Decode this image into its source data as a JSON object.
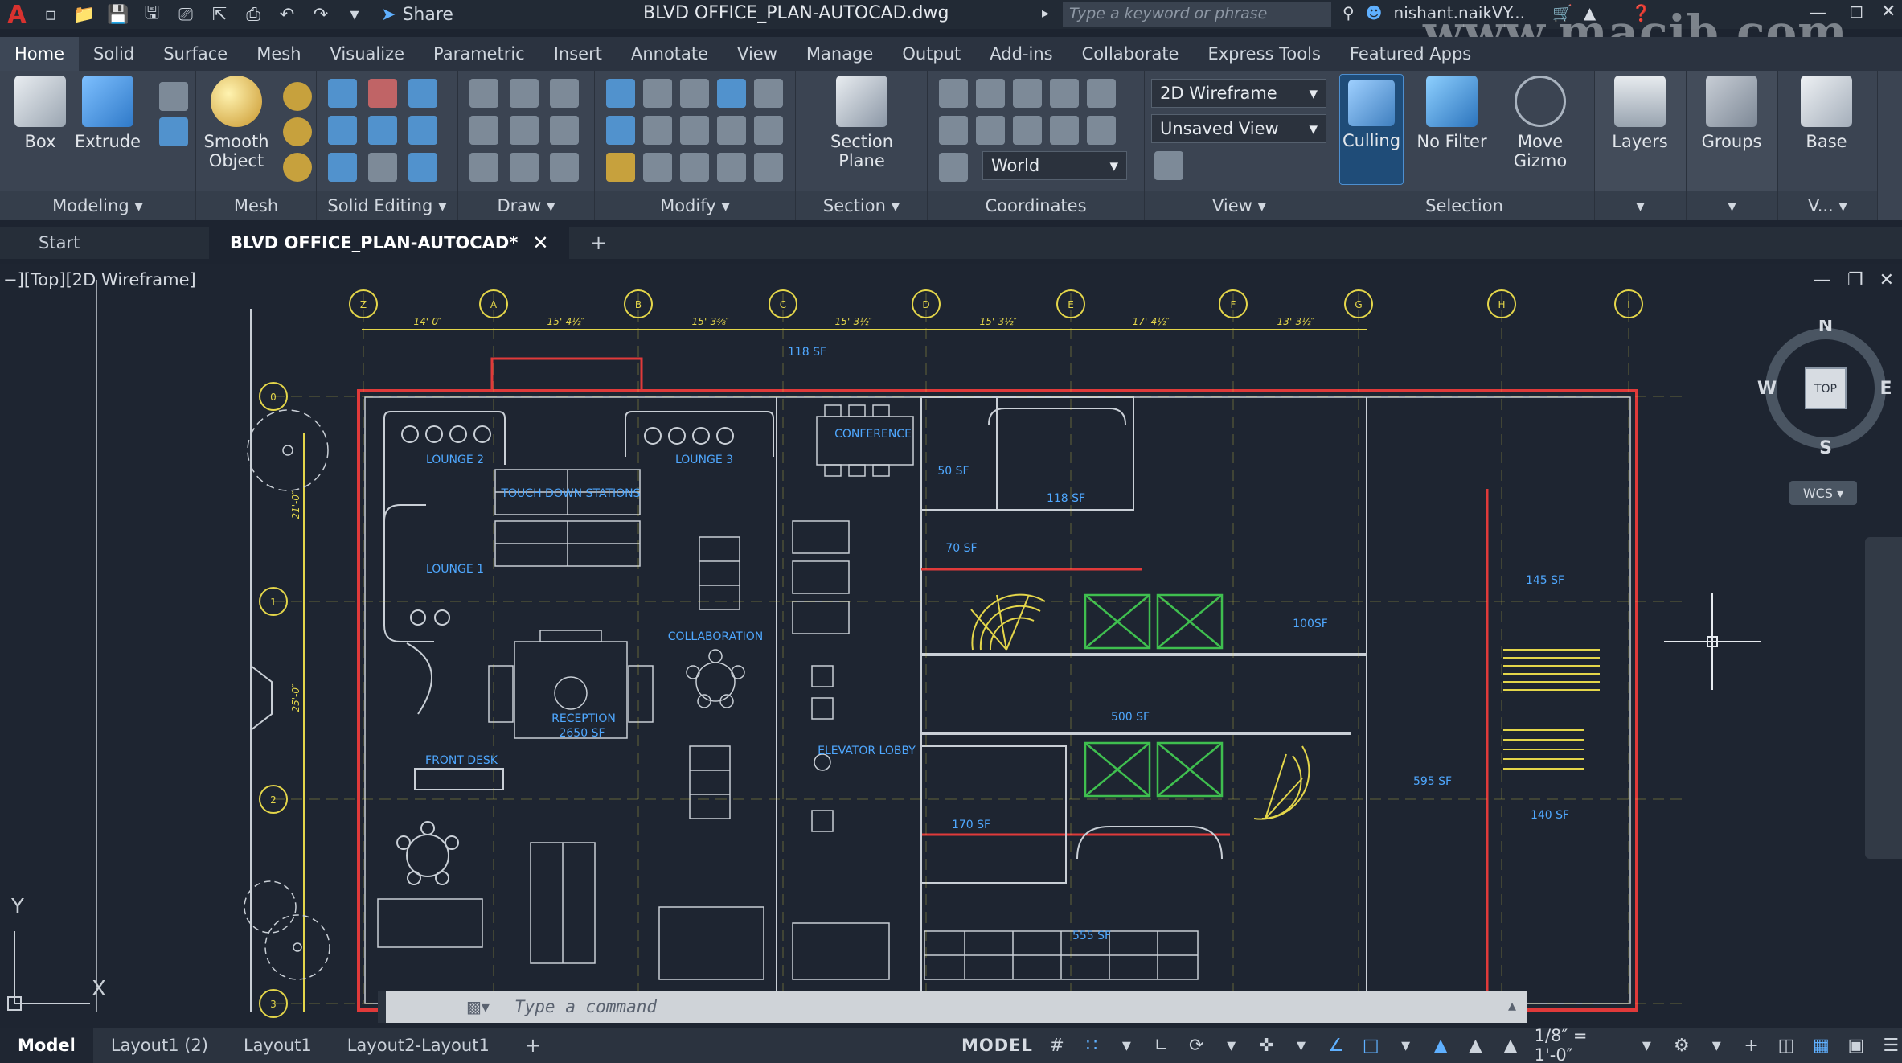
{
  "title_bar": {
    "app_logo": "A",
    "share_label": "Share",
    "document_title": "BLVD OFFICE_PLAN-AUTOCAD.dwg",
    "search_placeholder": "Type a keyword or phrase",
    "user_name": "nishant.naikVY...",
    "watermark": "www.macjb.com"
  },
  "menu_tabs": [
    "Home",
    "Solid",
    "Surface",
    "Mesh",
    "Visualize",
    "Parametric",
    "Insert",
    "Annotate",
    "View",
    "Manage",
    "Output",
    "Add-ins",
    "Collaborate",
    "Express Tools",
    "Featured Apps"
  ],
  "active_menu_tab": "Home",
  "ribbon": {
    "modeling": {
      "title": "Modeling",
      "box": "Box",
      "extrude": "Extrude"
    },
    "mesh": {
      "title": "Mesh",
      "smooth_object_line1": "Smooth",
      "smooth_object_line2": "Object"
    },
    "solid_editing": {
      "title": "Solid Editing"
    },
    "draw": {
      "title": "Draw"
    },
    "modify": {
      "title": "Modify"
    },
    "section": {
      "title": "Section",
      "section_plane_line1": "Section",
      "section_plane_line2": "Plane"
    },
    "coordinates": {
      "title": "Coordinates",
      "world": "World"
    },
    "view": {
      "title": "View",
      "visual_style": "2D Wireframe",
      "saved_view": "Unsaved View"
    },
    "selection": {
      "title": "Selection",
      "culling": "Culling",
      "no_filter": "No Filter",
      "move_gizmo_line1": "Move",
      "move_gizmo_line2": "Gizmo"
    },
    "layers": "Layers",
    "groups": "Groups",
    "base": "Base",
    "v_panel": "V..."
  },
  "doc_tabs": {
    "start": "Start",
    "active": "BLVD OFFICE_PLAN-AUTOCAD*"
  },
  "viewport": {
    "label": "−][Top][2D Wireframe]",
    "grid_columns": [
      "Z",
      "A",
      "B",
      "C",
      "D",
      "E",
      "F",
      "G",
      "H",
      "I"
    ],
    "grid_rows": [
      "0",
      "1",
      "2",
      "3"
    ],
    "dimensions": [
      "14'-0″",
      "15'-4½″",
      "15'-3⅜″",
      "15'-3½″",
      "15'-3½″",
      "17'-4½″",
      "13'-3½″"
    ],
    "side_dims": [
      "21'-0″",
      "25'-0″"
    ],
    "rooms": {
      "r118a": "118 SF",
      "lounge2": "LOUNGE 2",
      "lounge3": "LOUNGE 3",
      "conference": "CONFERENCE",
      "r50": "50 SF",
      "r118b": "118 SF",
      "touchdown": "TOUCH DOWN STATIONS",
      "lounge1": "LOUNGE 1",
      "r70": "70 SF",
      "r145": "145 SF",
      "collab": "COLLABORATION",
      "r100": "100SF",
      "reception": "RECEPTION",
      "r2650": "2650 SF",
      "r500": "500 SF",
      "frontdesk": "FRONT DESK",
      "elevator": "ELEVATOR LOBBY",
      "r595": "595 SF",
      "r170": "170 SF",
      "r140": "140 SF",
      "r555": "555 SF"
    },
    "compass": {
      "n": "N",
      "s": "S",
      "e": "E",
      "w": "W",
      "top": "TOP"
    },
    "wcs": "WCS",
    "ucs_y": "Y",
    "ucs_x": "X"
  },
  "command_line": {
    "placeholder": "Type a command"
  },
  "status_bar": {
    "layouts": [
      "Model",
      "Layout1 (2)",
      "Layout1",
      "Layout2-Layout1"
    ],
    "model_label": "MODEL",
    "scale": "1/8″ = 1'-0″"
  },
  "colors": {
    "wall_red": "#e03a3a",
    "grid_yellow": "#e4d64a",
    "furniture": "#c9cfd6",
    "room_label": "#4fa8ff",
    "green_cross": "#3fbf4f",
    "background": "#1e2531"
  }
}
